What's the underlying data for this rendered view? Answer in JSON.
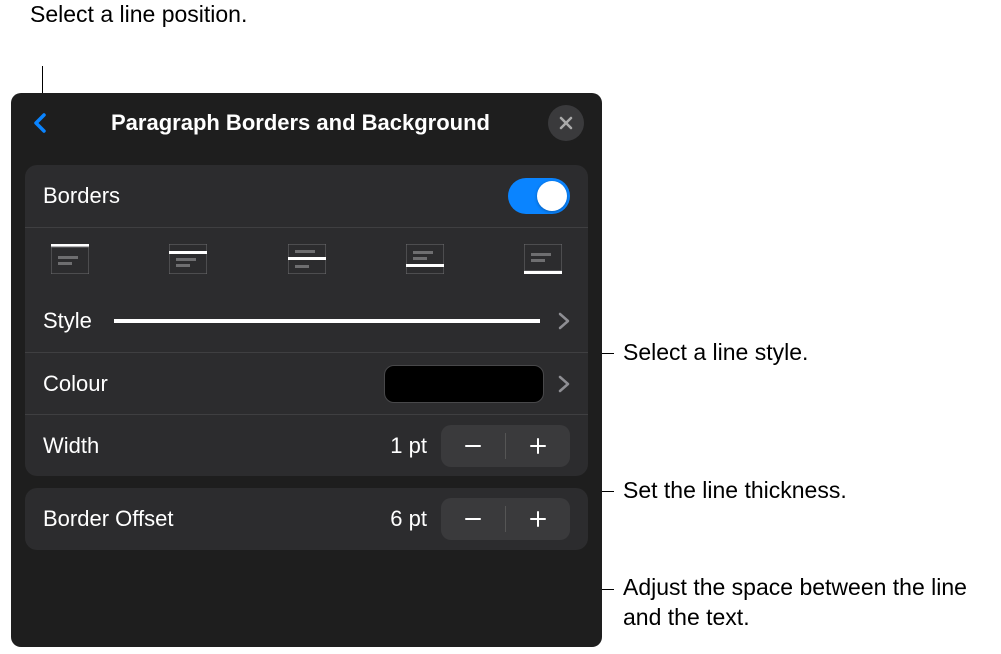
{
  "callouts": {
    "position": "Select a line position.",
    "style": "Select a line style.",
    "width": "Set the line thickness.",
    "offset": "Adjust the space between the line and the text."
  },
  "panel": {
    "title": "Paragraph Borders and Background",
    "borders": {
      "label": "Borders",
      "enabled": true
    },
    "positions": [
      "top",
      "middle-top",
      "middle",
      "middle-bottom",
      "bottom"
    ],
    "style": {
      "label": "Style",
      "value": "solid"
    },
    "colour": {
      "label": "Colour",
      "value": "#000000"
    },
    "width": {
      "label": "Width",
      "value": "1 pt"
    },
    "offset": {
      "label": "Border Offset",
      "value": "6 pt"
    }
  }
}
